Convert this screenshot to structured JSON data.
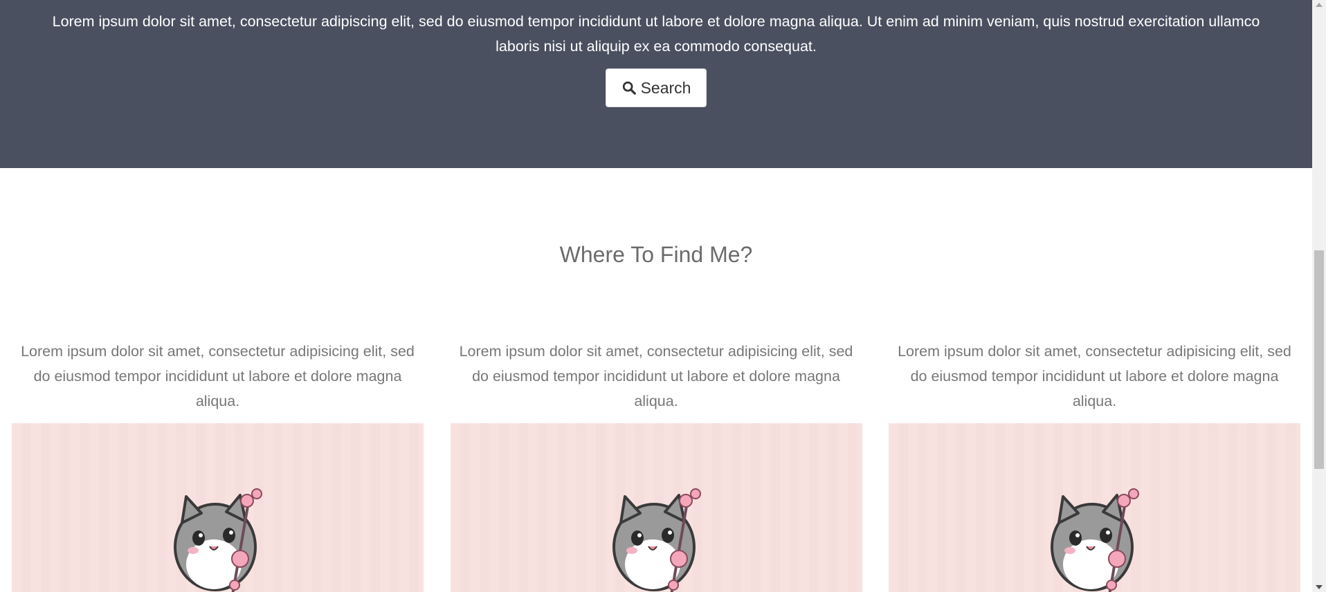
{
  "hero": {
    "text": "Lorem ipsum dolor sit amet, consectetur adipiscing elit, sed do eiusmod tempor incididunt ut labore et dolore magna aliqua. Ut enim ad minim veniam, quis nostrud exercitation ullamco laboris nisi ut aliquip ex ea commodo consequat.",
    "search_label": "Search",
    "search_icon": "search-icon",
    "background": "#4a5060"
  },
  "section": {
    "title": "Where To Find Me?"
  },
  "cards": [
    {
      "text": "Lorem ipsum dolor sit amet, consectetur adipisicing elit, sed do eiusmod tempor incididunt ut labore et dolore magna aliqua.",
      "image": "cat-with-flower-illustration"
    },
    {
      "text": "Lorem ipsum dolor sit amet, consectetur adipisicing elit, sed do eiusmod tempor incididunt ut labore et dolore magna aliqua.",
      "image": "cat-with-flower-illustration"
    },
    {
      "text": "Lorem ipsum dolor sit amet, consectetur adipisicing elit, sed do eiusmod tempor incididunt ut labore et dolore magna aliqua.",
      "image": "cat-with-flower-illustration"
    }
  ],
  "colors": {
    "hero_bg": "#4a5060",
    "card_image_bg": "#f8e2e0",
    "title_color": "#6b6b6b",
    "body_text": "#777777"
  }
}
